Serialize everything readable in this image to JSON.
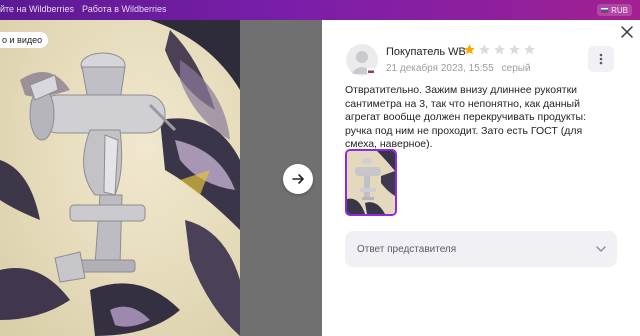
{
  "topbar": {
    "link1": "йте на Wildberries",
    "link2": "Работа в Wildberries",
    "currency": "RUB"
  },
  "photo": {
    "label": "о и видео"
  },
  "review": {
    "author": "Покупатель WB",
    "rating": 1,
    "max_rating": 5,
    "date": "21 декабря 2023, 15:55",
    "color": "серый",
    "text": "Отвратительно. Зажим внизу длиннее рукоятки сантиметра на 3, так что непонятно, как данный агрегат вообще должен перекручивать продукты: ручка под ним не проходит. Зато есть ГОСТ (для смеха, наверное).",
    "reply_label": "Ответ представителя"
  },
  "icons": {
    "next": "arrow-right-icon",
    "close": "close-icon",
    "more": "more-vertical-icon",
    "reply_toggle": "chevron-down-icon",
    "star": "star-icon"
  },
  "colors": {
    "brand_purple": "#8a2be2",
    "star_filled": "#ffa800",
    "star_empty": "#dcdce0"
  }
}
